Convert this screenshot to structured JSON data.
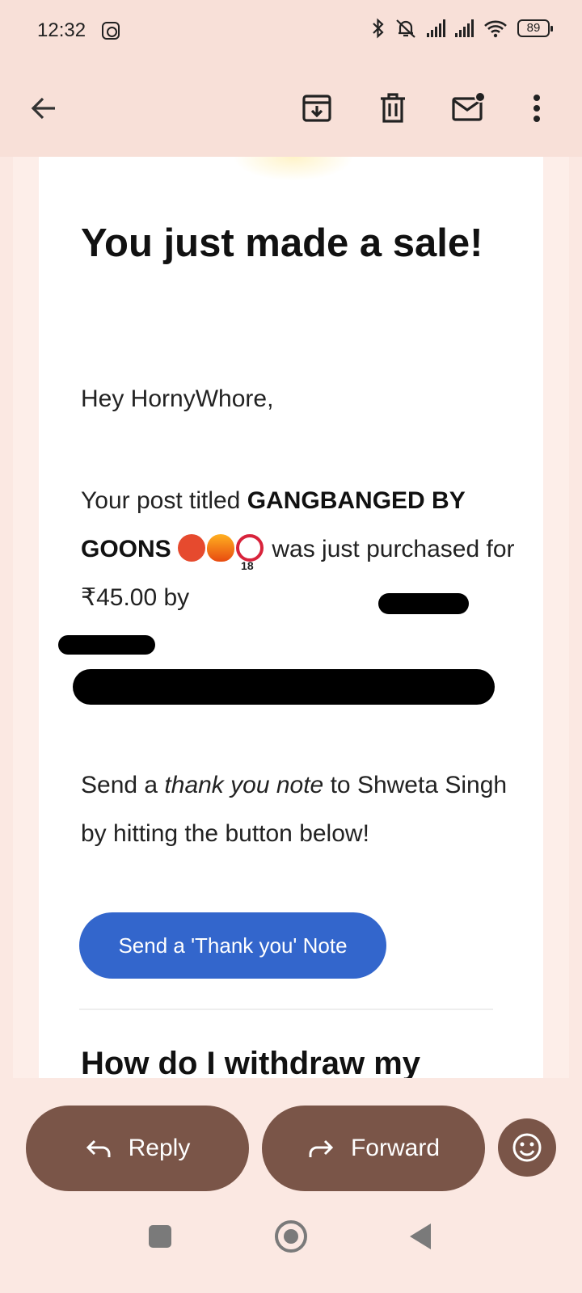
{
  "status_bar": {
    "time": "12:32",
    "battery": "89",
    "icons": [
      "instagram-icon",
      "bluetooth-icon",
      "mute-icon",
      "signal-icon",
      "signal-icon",
      "wifi-icon",
      "battery-icon"
    ]
  },
  "toolbar": {
    "icons": [
      "back-arrow-icon",
      "archive-icon",
      "delete-icon",
      "mark-unread-icon",
      "more-options-icon"
    ]
  },
  "email": {
    "headline": "You just made a sale!",
    "greeting": "Hey HornyWhore,",
    "post_prefix": "Your post titled ",
    "post_title": "GANGBANGED BY GOONS",
    "post_emojis": [
      "hot-face-emoji",
      "fire-emoji",
      "no-one-under-18-emoji"
    ],
    "post_middle": " was just purchased for ₹45.00 by",
    "thank_prefix": "Send a ",
    "thank_italic": "thank you note",
    "thank_suffix": " to Shweta Singh by hitting the button below!",
    "cta_label": "Send a 'Thank you' Note",
    "next_heading": "How do I withdraw my"
  },
  "actions": {
    "reply_label": "Reply",
    "forward_label": "Forward"
  },
  "colors": {
    "accent_button": "#3366cc",
    "action_pill": "#7a5548",
    "app_bar": "#f8e0d8"
  }
}
